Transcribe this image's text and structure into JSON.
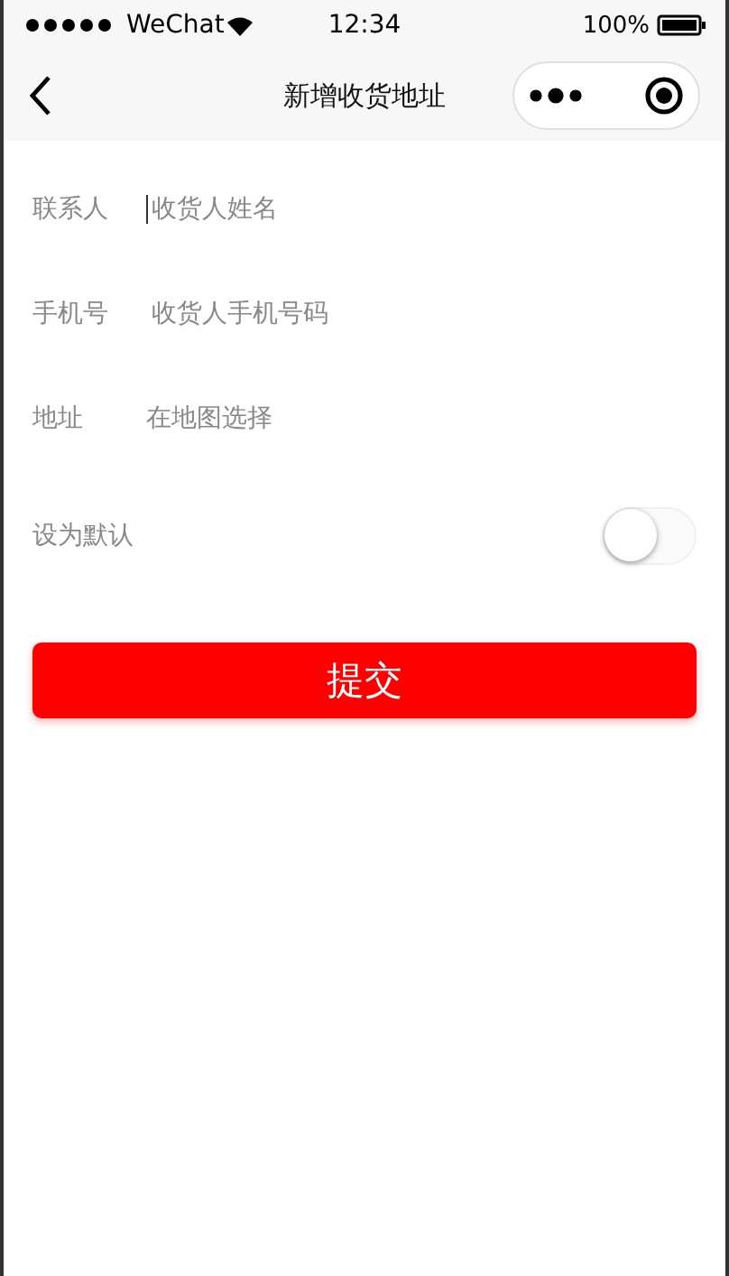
{
  "status_bar": {
    "carrier": "WeChat",
    "time": "12:34",
    "battery": "100%"
  },
  "nav": {
    "title": "新增收货地址"
  },
  "fields": [
    {
      "kind": "input",
      "label": "联系人",
      "placeholder": "收货人姓名",
      "focused": true
    },
    {
      "kind": "input",
      "label": "手机号",
      "placeholder": "收货人手机号码",
      "focused": false
    },
    {
      "kind": "picker",
      "label": "地址",
      "value": "在地图选择"
    }
  ],
  "default_switch": {
    "label": "设为默认",
    "on": false
  },
  "submit": {
    "label": "提交"
  }
}
